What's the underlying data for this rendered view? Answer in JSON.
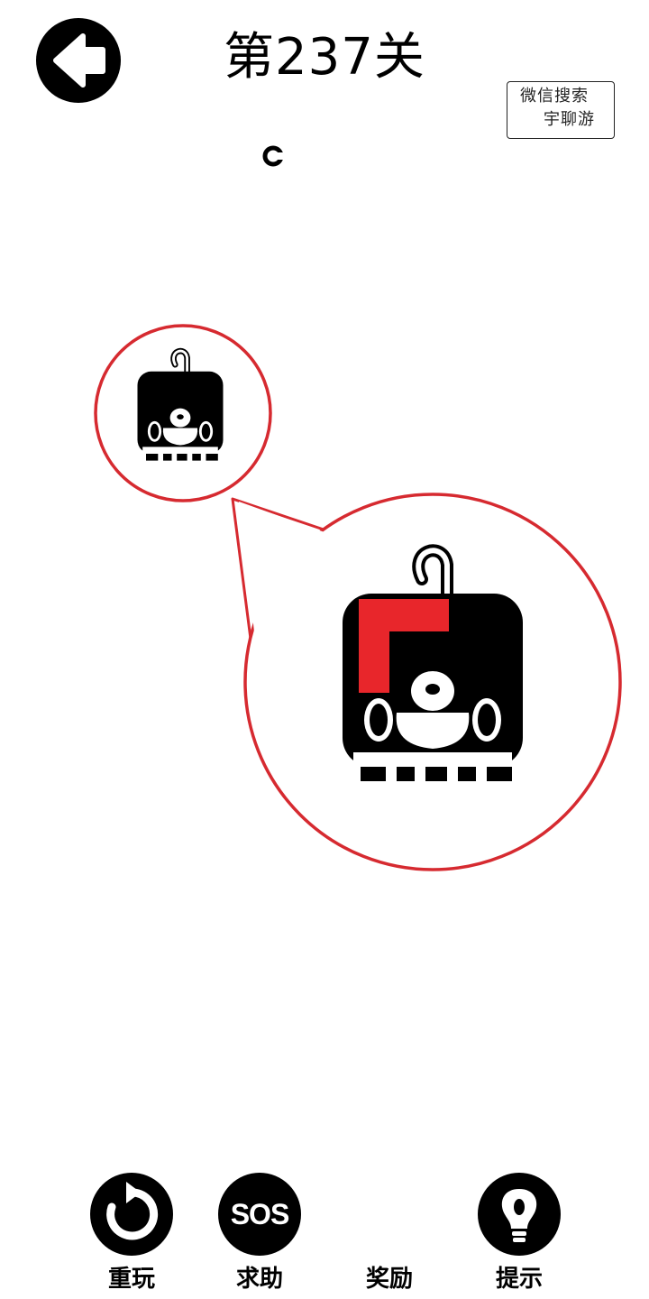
{
  "header": {
    "title": "第237关",
    "back_icon": "arrow-left-icon"
  },
  "stamp": {
    "line1": "微信搜索",
    "line2": "宇聊游"
  },
  "scene": {
    "zoom_icon": "magnifier-callout",
    "highlight_color": "#e8262b",
    "outline_color": "#d62a30"
  },
  "toolbar": {
    "replay_label": "重玩",
    "sos_label": "求助",
    "sos_icon_text": "SOS",
    "reward_label": "奖励",
    "hint_label": "提示"
  }
}
